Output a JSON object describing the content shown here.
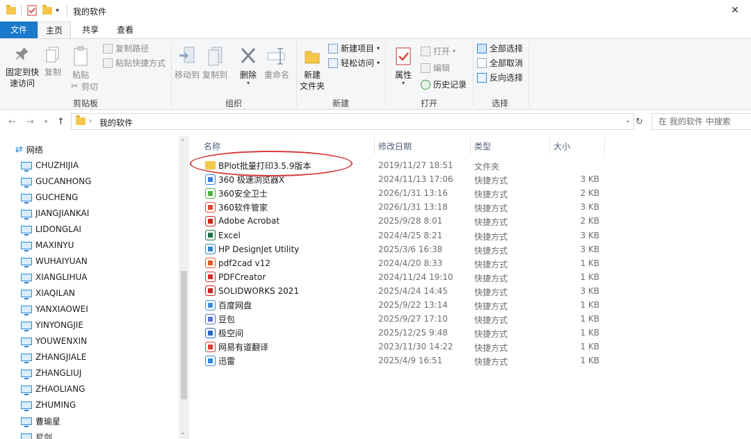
{
  "window": {
    "title": "我的软件",
    "close": "✕"
  },
  "tabs": {
    "file": "文件",
    "home": "主页",
    "share": "共享",
    "view": "查看"
  },
  "ribbon": {
    "clipboard": {
      "pin": "固定到快速访问",
      "pin_l1": "固定到快",
      "pin_l2": "速访问",
      "copy": "复制",
      "paste": "粘贴",
      "copy_path": "复制路径",
      "paste_shortcut": "粘贴快捷方式",
      "cut": "剪切",
      "label": "剪贴板"
    },
    "organize": {
      "move_to": "移动到",
      "copy_to": "复制到",
      "delete": "删除",
      "rename": "重命名",
      "label": "组织"
    },
    "new": {
      "new_folder_l1": "新建",
      "new_folder_l2": "文件夹",
      "new_item": "新建项目",
      "easy_access": "轻松访问",
      "label": "新建"
    },
    "open": {
      "properties": "属性",
      "open": "打开",
      "edit": "编辑",
      "history": "历史记录",
      "label": "打开"
    },
    "select": {
      "select_all": "全部选择",
      "select_none": "全部取消",
      "invert": "反向选择",
      "label": "选择"
    }
  },
  "address": {
    "path": "我的软件",
    "search_placeholder": "在 我的软件 中搜索"
  },
  "nav": {
    "network": "网络",
    "computers": [
      "CHUZHIJIA",
      "GUCANHONG",
      "GUCHENG",
      "JIANGJIANKAI",
      "LIDONGLAI",
      "MAXINYU",
      "WUHAIYUAN",
      "XIANGLIHUA",
      "XIAQILAN",
      "YANXIAOWEI",
      "YINYONGJIE",
      "YOUWENXIN",
      "ZHANGJIALE",
      "ZHANGLIUJ",
      "ZHAOLIANG",
      "ZHUMING",
      "曹瑜星",
      "尼剑"
    ]
  },
  "columns": {
    "name": "名称",
    "date": "修改日期",
    "type": "类型",
    "size": "大小"
  },
  "files": [
    {
      "name": "BPlot批量打印3.5.9版本",
      "date": "2019/11/27 18:51",
      "type": "文件夹",
      "size": "",
      "icon": "folder-icon",
      "color": "#f3c74c"
    },
    {
      "name": "360 极速浏览器X",
      "date": "2024/11/13 17:06",
      "type": "快捷方式",
      "size": "3 KB",
      "icon": "360-browser-icon",
      "color": "#3a7be0"
    },
    {
      "name": "360安全卫士",
      "date": "2026/1/31 13:16",
      "type": "快捷方式",
      "size": "2 KB",
      "icon": "360-safe-icon",
      "color": "#4caf3c"
    },
    {
      "name": "360软件管家",
      "date": "2026/1/31 13:18",
      "type": "快捷方式",
      "size": "3 KB",
      "icon": "360-manager-icon",
      "color": "#e04a3a"
    },
    {
      "name": "Adobe Acrobat",
      "date": "2025/9/28 8:01",
      "type": "快捷方式",
      "size": "2 KB",
      "icon": "acrobat-icon",
      "color": "#c8281e"
    },
    {
      "name": "Excel",
      "date": "2024/4/25 8:21",
      "type": "快捷方式",
      "size": "3 KB",
      "icon": "excel-icon",
      "color": "#1e7145"
    },
    {
      "name": "HP DesignJet Utility",
      "date": "2025/3/6 16:38",
      "type": "快捷方式",
      "size": "3 KB",
      "icon": "hp-icon",
      "color": "#2f86c8"
    },
    {
      "name": "pdf2cad v12",
      "date": "2024/4/20 8:33",
      "type": "快捷方式",
      "size": "1 KB",
      "icon": "pdf2cad-icon",
      "color": "#e05a2a"
    },
    {
      "name": "PDFCreator",
      "date": "2024/11/24 19:10",
      "type": "快捷方式",
      "size": "1 KB",
      "icon": "pdfcreator-icon",
      "color": "#d23030"
    },
    {
      "name": "SOLIDWORKS 2021",
      "date": "2025/4/24 14:45",
      "type": "快捷方式",
      "size": "3 KB",
      "icon": "solidworks-icon",
      "color": "#c52828"
    },
    {
      "name": "百度网盘",
      "date": "2025/9/22 13:14",
      "type": "快捷方式",
      "size": "1 KB",
      "icon": "baidu-netdisk-icon",
      "color": "#3d8fe0"
    },
    {
      "name": "豆包",
      "date": "2025/9/27 17:10",
      "type": "快捷方式",
      "size": "1 KB",
      "icon": "doubao-icon",
      "color": "#5b6fd6"
    },
    {
      "name": "极空间",
      "date": "2025/12/25 9:48",
      "type": "快捷方式",
      "size": "1 KB",
      "icon": "zspace-icon",
      "color": "#2a64c8"
    },
    {
      "name": "网易有道翻译",
      "date": "2023/11/30 14:22",
      "type": "快捷方式",
      "size": "1 KB",
      "icon": "youdao-icon",
      "color": "#e23b3b"
    },
    {
      "name": "迅雷",
      "date": "2025/4/9 16:51",
      "type": "快捷方式",
      "size": "1 KB",
      "icon": "xunlei-icon",
      "color": "#2d8ae0"
    }
  ]
}
